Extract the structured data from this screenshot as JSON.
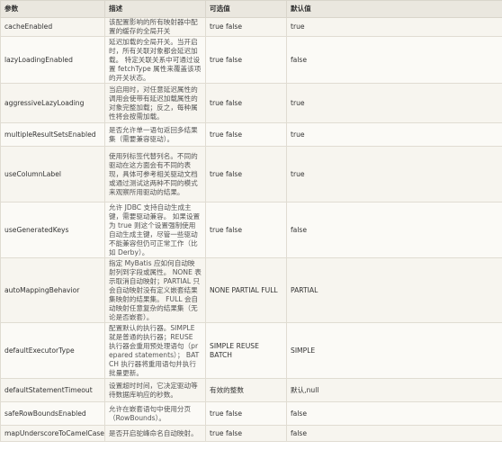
{
  "header": {
    "param": "参数",
    "description": "描述",
    "values": "可选值",
    "default": "默认值"
  },
  "rows": [
    {
      "name": "cacheEnabled",
      "description": "该配置影响的所有映射器中配置的缓存的全局开关",
      "values": "true false",
      "default": "true",
      "height": 20
    },
    {
      "name": "lazyLoadingEnabled",
      "description": "延迟加载的全局开关。当开启时，所有关联对象都会延迟加载。 特定关联关系中可通过设置 fetchType 属性来覆盖该项的开关状态。",
      "values": "true false",
      "default": "false",
      "height": 52
    },
    {
      "name": "aggressiveLazyLoading",
      "description": "当启用时，对任意延迟属性的调用会使带有延迟加载属性的对象完整加载；反之，每种属性将会按需加载。",
      "values": "true false",
      "default": "true",
      "height": 44
    },
    {
      "name": "multipleResultSetsEnabled",
      "description": "是否允许单一语句返回多结果集（需要兼容驱动）。",
      "values": "true false",
      "default": "true",
      "height": 26
    },
    {
      "name": "useColumnLabel",
      "description": "使用列标签代替列名。不同的驱动在这方面会有不同的表现，具体可参考相关驱动文档或通过测试这两种不同的模式来观察所用驱动的结果。",
      "values": "true false",
      "default": "true",
      "height": 62
    },
    {
      "name": "useGeneratedKeys",
      "description": "允许 JDBC 支持自动生成主键，需要驱动兼容。 如果设置为 true 则这个设置强制使用自动生成主键，尽管一些驱动不能兼容但仍可正常工作（比如 Derby）。",
      "values": "true false",
      "default": "false",
      "height": 62
    },
    {
      "name": "autoMappingBehavior",
      "description": "指定 MyBatis 应如何自动映射列到字段或属性。 NONE 表示取消自动映射；PARTIAL 只会自动映射没有定义嵌套结果集映射的结果集。 FULL 会自动映射任意复杂的结果集（无论是否嵌套）。",
      "values": "NONE PARTIAL FULL",
      "default": "PARTIAL",
      "height": 72
    },
    {
      "name": "defaultExecutorType",
      "description": "配置默认的执行器。SIMPLE 就是普通的执行器；REUSE 执行器会重用预处理语句（prepared statements）； BATCH 执行器将重用语句并执行批量更新。",
      "values": "SIMPLE REUSE BATCH",
      "default": "SIMPLE",
      "height": 62
    },
    {
      "name": "defaultStatementTimeout",
      "description": "设置超时时间，它决定驱动等待数据库响应的秒数。",
      "values": "有效的整数",
      "default": "默认,null",
      "height": 26
    },
    {
      "name": "safeRowBoundsEnabled",
      "description": "允许在嵌套语句中使用分页（RowBounds）。",
      "values": "true false",
      "default": "false",
      "height": 26
    },
    {
      "name": "mapUnderscoreToCamelCase",
      "description": "是否开启驼峰命名自动映射。",
      "values": "true false",
      "default": "false",
      "height": 18
    }
  ]
}
